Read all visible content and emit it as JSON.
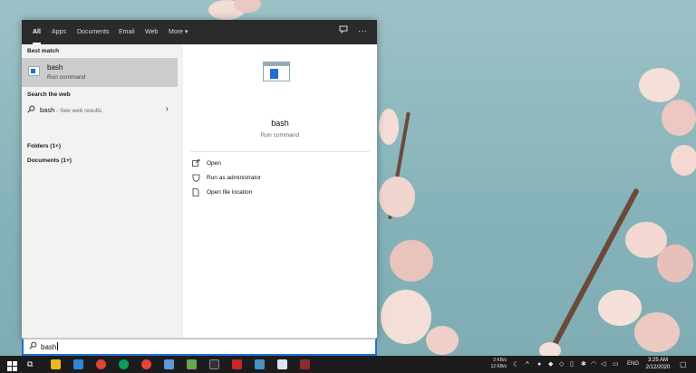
{
  "tabs": [
    "All",
    "Apps",
    "Documents",
    "Email",
    "Web",
    "More"
  ],
  "more_caret": "▾",
  "left": {
    "best_match_header": "Best match",
    "best_match_title": "bash",
    "best_match_sub": "Run command",
    "search_web_header": "Search the web",
    "web_query": "bash",
    "web_hint": " - See web results",
    "folders": "Folders (1+)",
    "documents": "Documents (1+)"
  },
  "right": {
    "title": "bash",
    "subtitle": "Run command",
    "actions": [
      "Open",
      "Run as administrator",
      "Open file location"
    ]
  },
  "search": {
    "value": "bash"
  },
  "tray": {
    "net_up": "2 KB/s",
    "net_down": "12 KB/s",
    "lang": "ENG",
    "time": "3:25 AM",
    "date": "2/12/2020"
  },
  "icons": {
    "search": "magnifier-icon",
    "feedback": "feedback-icon",
    "options": "ellipsis-icon"
  },
  "colors": {
    "accent": "#1f6fd0",
    "tabbar": "#2b2b2b",
    "selected": "#cccccc"
  }
}
